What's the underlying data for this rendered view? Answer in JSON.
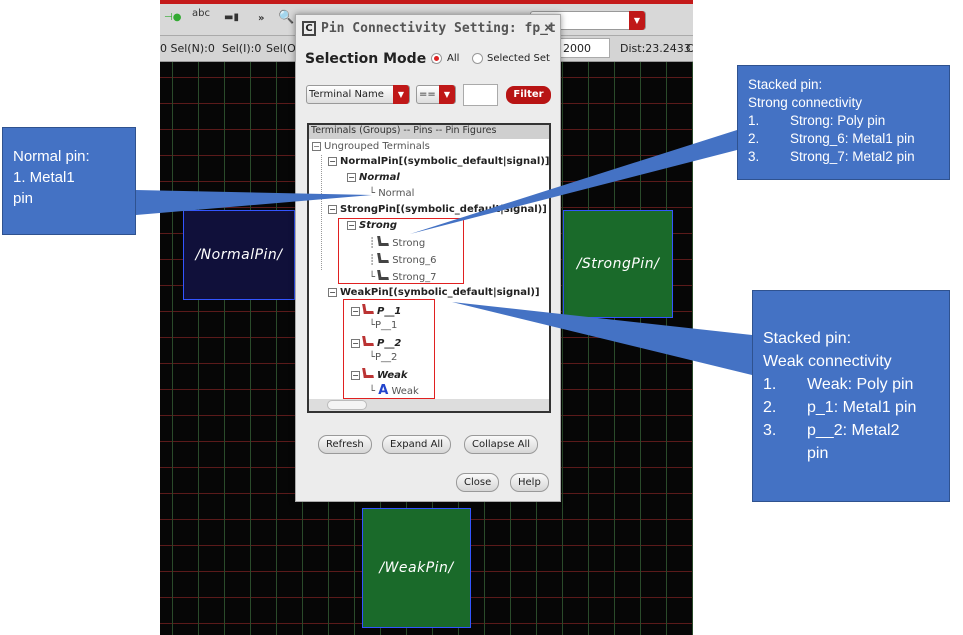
{
  "toolbar": {
    "abc_label": "abc",
    "more": "»"
  },
  "statusbar": {
    "sel_n": "0  Sel(N):0",
    "sel_i": "Sel(I):0",
    "sel_o": "Sel(O)",
    "coord": "2000",
    "dist": "Dist:23.2433",
    "c": "C"
  },
  "pins": {
    "normal": "/NormalPin/",
    "strong": "/StrongPin/",
    "weak": "/WeakPin/"
  },
  "dialog": {
    "title": "Pin Connectivity Setting: fp_t",
    "close": "×",
    "selection_label": "Selection Mode :",
    "mode_all": "All",
    "mode_selected": "Selected Set",
    "filter_field": "Terminal Name",
    "operator": "==",
    "filter_value": "",
    "filter_button": "Filter",
    "tree_header": "Terminals (Groups) -- Pins -- Pin Figures",
    "tree": {
      "ungrouped": "Ungrouped Terminals",
      "normalpin": "NormalPin[(symbolic_default|signal)]",
      "normal_pin": "Normal",
      "normal_fig": "Normal",
      "strongpin": "StrongPin[(symbolic_default|signal)]",
      "strong_pin": "Strong",
      "strong_figs": [
        "Strong",
        "Strong_6",
        "Strong_7"
      ],
      "weakpin": "WeakPin[(symbolic_default|signal)]",
      "p1": "P__1",
      "p1_fig": "P__1",
      "p2": "P__2",
      "p2_fig": "P__2",
      "weak": "Weak",
      "weak_fig": "Weak"
    },
    "refresh": "Refresh",
    "expand_all": "Expand All",
    "collapse_all": "Collapse All",
    "close_button": "Close",
    "help": "Help"
  },
  "callouts": {
    "normal": [
      "Normal pin:",
      "1. Metal1",
      "pin"
    ],
    "strong": {
      "title": [
        "Stacked pin:",
        "Strong connectivity"
      ],
      "items": [
        [
          "1.",
          "Strong: Poly pin"
        ],
        [
          "2.",
          "Strong_6: Metal1 pin"
        ],
        [
          "3.",
          "Strong_7: Metal2 pin"
        ]
      ]
    },
    "weak": {
      "title": [
        "Stacked pin:",
        "Weak connectivity"
      ],
      "items": [
        [
          "1.",
          "Weak: Poly pin"
        ],
        [
          "2.",
          "p_1: Metal1 pin"
        ],
        [
          "3.",
          "p__2: Metal2"
        ],
        [
          "",
          "pin"
        ]
      ]
    }
  },
  "colors": {
    "accent": "#c01818",
    "callout": "#4472c4",
    "highlight": "#e02020"
  }
}
